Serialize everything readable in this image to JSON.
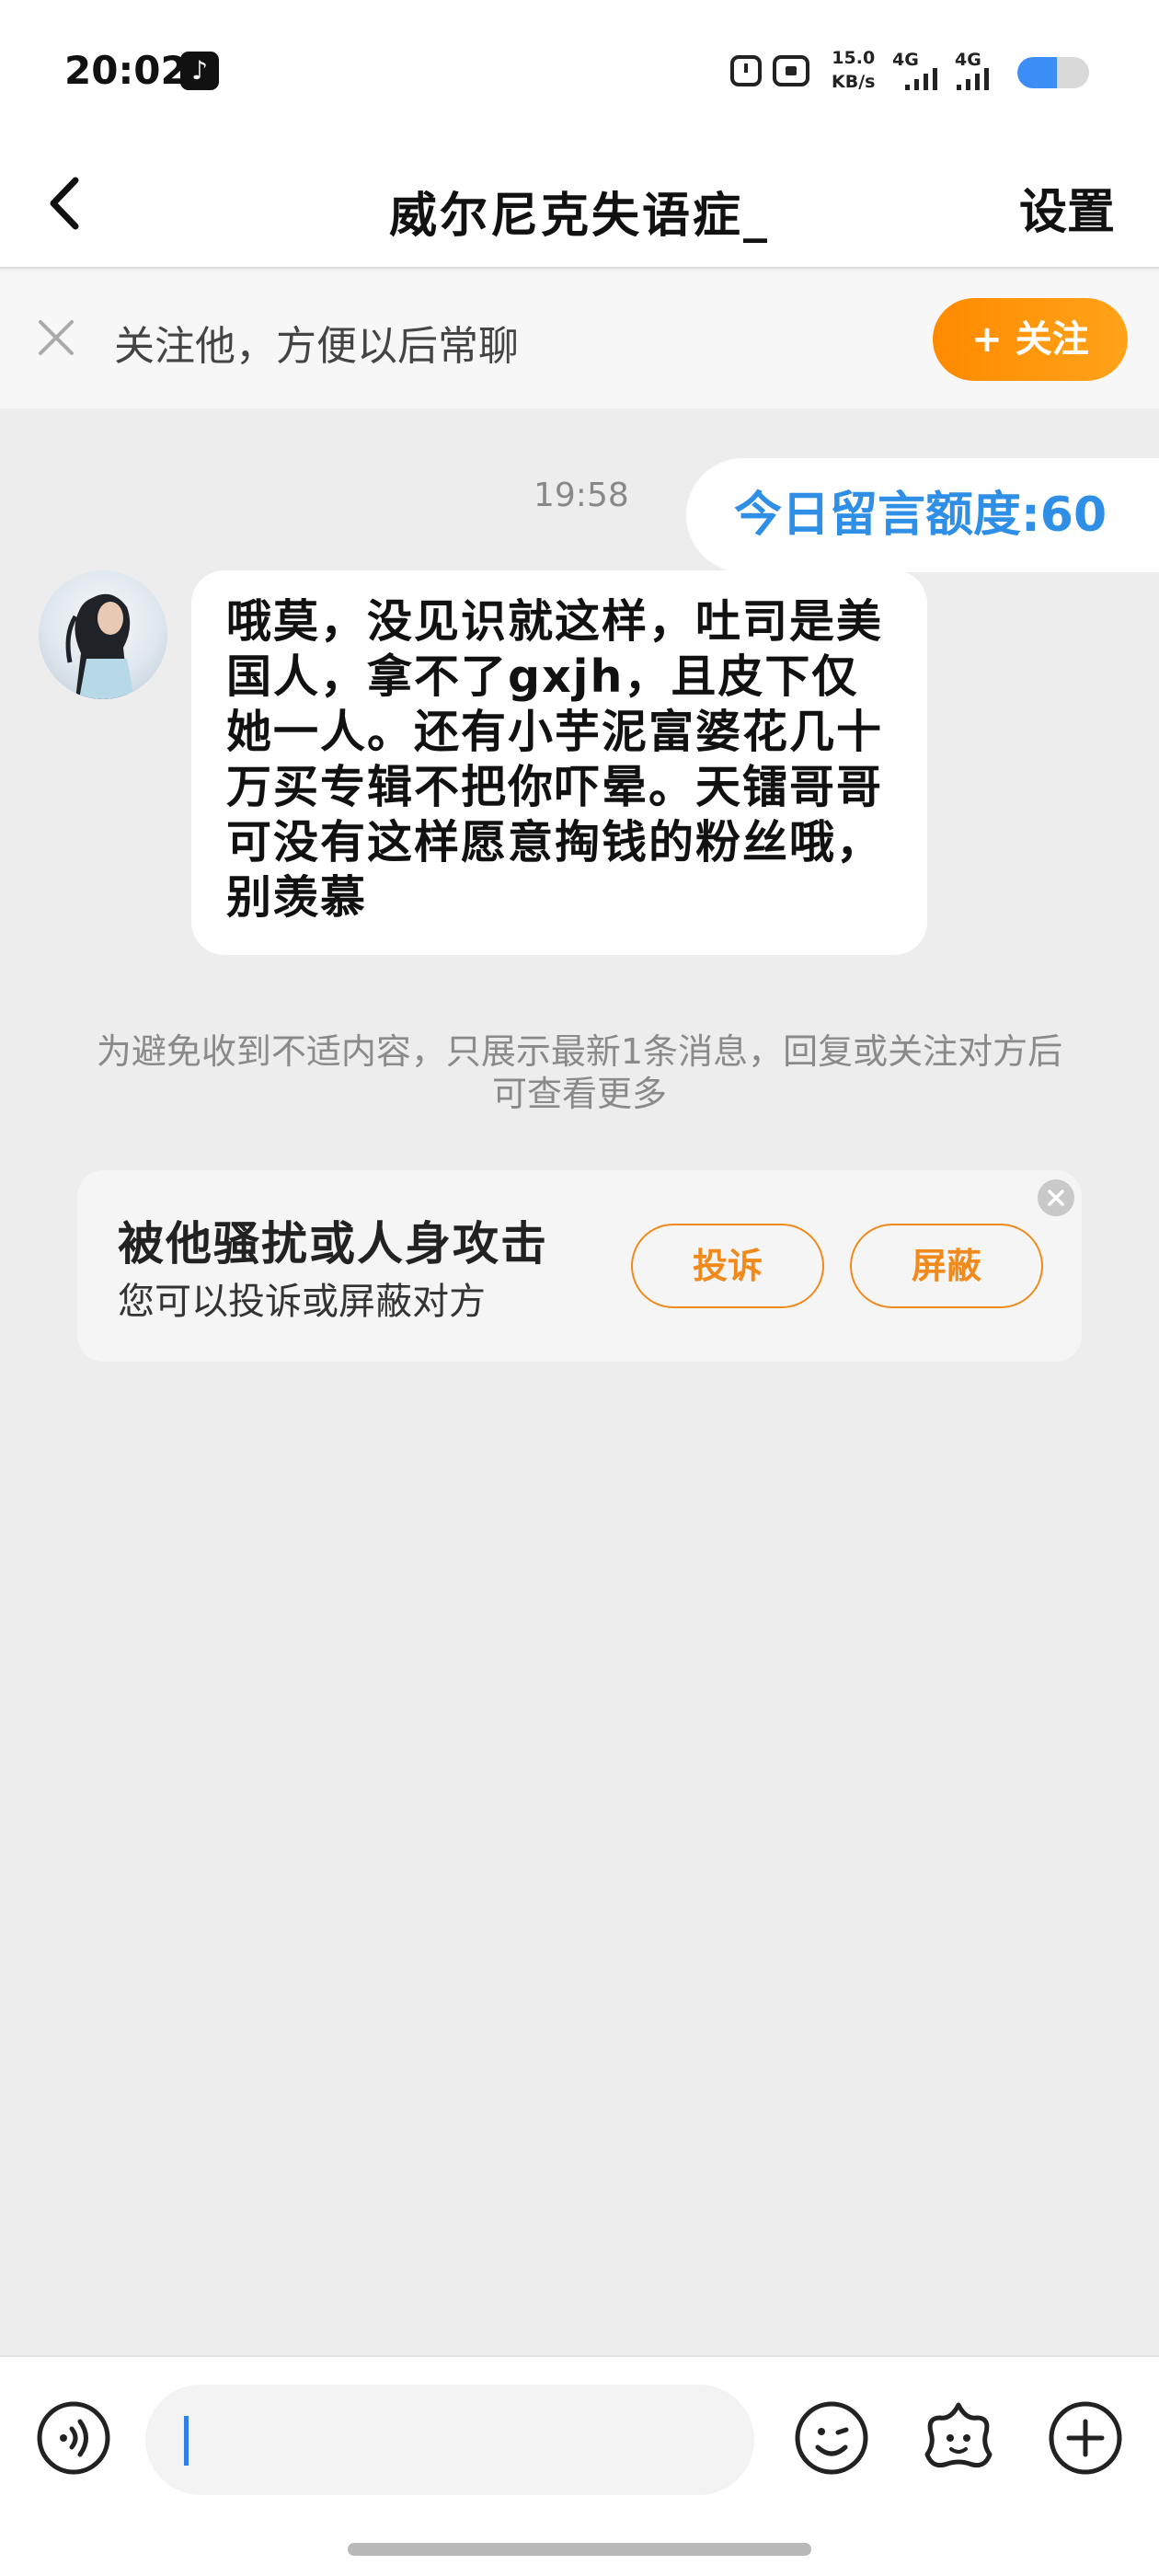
{
  "status": {
    "time": "20:02",
    "net_speed_value": "15.0",
    "net_speed_unit": "KB/s",
    "signal_1": "4G",
    "signal_2": "4G",
    "battery_percent": 55
  },
  "nav": {
    "title": "威尔尼克失语症_",
    "settings_label": "设置"
  },
  "follow_bar": {
    "prompt": "关注他，方便以后常聊",
    "button_label": "+ 关注"
  },
  "chat": {
    "timestamp": "19:58",
    "quota_label": "今日留言额度:60",
    "message": "哦莫，没见识就这样，吐司是美国人，拿不了gxjh，且皮下仅她一人。还有小芋泥富婆花几十万买专辑不把你吓晕。天镭哥哥可没有这样愿意掏钱的粉丝哦，别羡慕",
    "notice": "为避免收到不适内容，只展示最新1条消息，回复或关注对方后可查看更多"
  },
  "report_card": {
    "title": "被他骚扰或人身攻击",
    "subtitle": "您可以投诉或屏蔽对方",
    "complain_label": "投诉",
    "block_label": "屏蔽"
  },
  "bottom": {
    "icons": [
      "voice-icon",
      "emoji-icon",
      "sticker-icon",
      "plus-icon"
    ]
  },
  "colors": {
    "accent_orange": "#ff9500",
    "quota_blue": "#2f8fe6",
    "page_bg": "#ededed"
  }
}
